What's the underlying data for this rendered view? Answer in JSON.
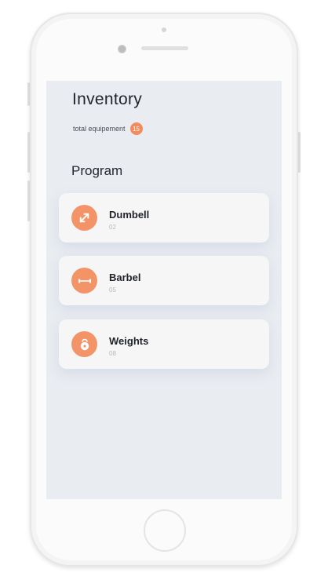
{
  "inventory": {
    "title": "Inventory",
    "subtitle": "total equipement",
    "count": "15"
  },
  "program": {
    "title": "Program",
    "items": [
      {
        "name": "Dumbell",
        "number": "02",
        "icon": "expand-arrows-icon"
      },
      {
        "name": "Barbel",
        "number": "05",
        "icon": "barbell-icon"
      },
      {
        "name": "Weights",
        "number": "08",
        "icon": "kettlebell-icon"
      }
    ]
  },
  "colors": {
    "accent": "#f39468",
    "screen_bg": "#e9ecf1",
    "card_bg": "#f6f6f7",
    "text_dark": "#23262d"
  }
}
